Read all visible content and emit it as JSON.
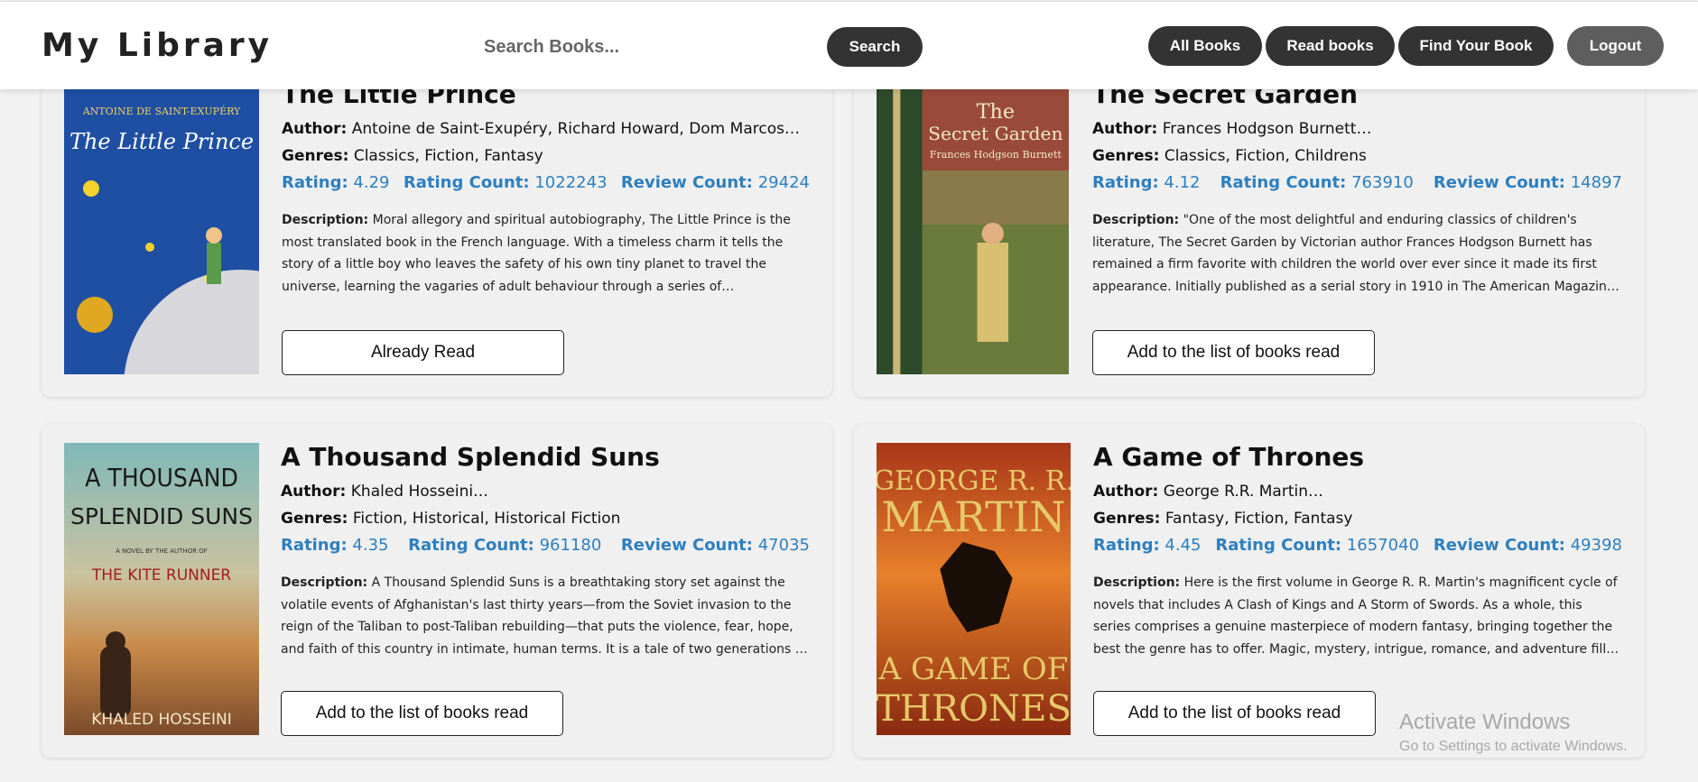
{
  "header": {
    "brand": "My Library",
    "search_placeholder": "Search Books...",
    "search_button": "Search",
    "nav": [
      "All Books",
      "Read books",
      "Find Your Book"
    ],
    "logout": "Logout"
  },
  "labels": {
    "author": "Author:",
    "genres": "Genres:",
    "rating": "Rating:",
    "rating_count": "Rating Count:",
    "review_count": "Review Count:",
    "description": "Description:"
  },
  "books": [
    {
      "title": "The Little Prince",
      "author": "Antoine de Saint-Exupéry, Richard Howard, Dom Marcos…",
      "genres": "Classics, Fiction, Fantasy",
      "rating": "4.29",
      "rating_count": "1022243",
      "review_count": "29424",
      "description": "Moral allegory and spiritual autobiography, The Little Prince is the most translated book in the French language. With a timeless charm it tells the story of a little boy who leaves the safety of his own tiny planet to travel the universe, learning the vagaries of adult behaviour through a series of extraordinary encounters. His personal odyssey culminates in a voyage to Earth.",
      "button": "Already Read",
      "cover_lines": [
        "ANTOINE DE SAINT-EXUPÉRY",
        "The Little Prince"
      ]
    },
    {
      "title": "The Secret Garden",
      "author": "Frances Hodgson Burnett…",
      "genres": "Classics, Fiction, Childrens",
      "rating": "4.12",
      "rating_count": "763910",
      "review_count": "14897",
      "description": "\"One of the most delightful and enduring classics of children's literature, The Secret Garden by Victorian author Frances Hodgson Burnett has remained a firm favorite with children the world over ever since it made its first appearance. Initially published as a serial story in 1910 in The American Magazine, it was brought out in novel form the following year.",
      "button": "Add to the list of books read",
      "cover_lines": [
        "The",
        "Secret Garden",
        "Frances Hodgson Burnett"
      ]
    },
    {
      "title": "A Thousand Splendid Suns",
      "author": "Khaled Hosseini…",
      "genres": "Fiction, Historical, Historical Fiction",
      "rating": "4.35",
      "rating_count": "961180",
      "review_count": "47035",
      "description": "A Thousand Splendid Suns is a breathtaking story set against the volatile events of Afghanistan's last thirty years—from the Soviet invasion to the reign of the Taliban to post-Taliban rebuilding—that puts the violence, fear, hope, and faith of this country in intimate, human terms. It is a tale of two generations of characters brought together by the tragic sweep of war.",
      "button": "Add to the list of books read",
      "cover_lines": [
        "A THOUSAND",
        "SPLENDID SUNS",
        "A NOVEL BY THE AUTHOR OF",
        "THE KITE RUNNER",
        "KHALED HOSSEINI"
      ]
    },
    {
      "title": "A Game of Thrones",
      "author": "George R.R. Martin…",
      "genres": "Fantasy, Fiction, Fantasy",
      "rating": "4.45",
      "rating_count": "1657040",
      "review_count": "49398",
      "description": "Here is the first volume in George R. R. Martin's magnificent cycle of novels that includes A Clash of Kings and A Storm of Swords. As a whole, this series comprises a genuine masterpiece of modern fantasy, bringing together the best the genre has to offer. Magic, mystery, intrigue, romance, and adventure fill these pages and transport us to a world unlike any we have ever experienced.",
      "button": "Add to the list of books read",
      "cover_lines": [
        "GEORGE R. R.",
        "MARTIN",
        "A GAME OF",
        "THRONES"
      ]
    }
  ],
  "watermark": {
    "line1": "Activate Windows",
    "line2": "Go to Settings to activate Windows."
  },
  "colors": {
    "stat_blue": "#2e7fbf",
    "pill_dark": "#333333",
    "logout_gray": "#5e5e5e"
  }
}
